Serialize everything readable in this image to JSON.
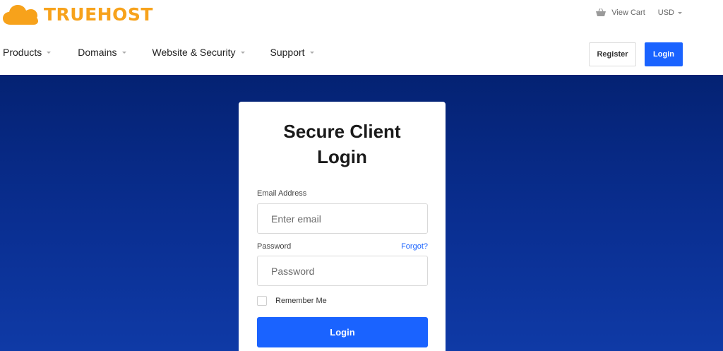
{
  "brand": {
    "name": "TRUEHOST",
    "logo_icon": "cloud-icon",
    "color": "#f7a21b"
  },
  "topbar": {
    "cart_label": "View Cart",
    "cart_icon": "basket-icon",
    "currency": "USD"
  },
  "nav": {
    "items": [
      {
        "label": "Products"
      },
      {
        "label": "Domains"
      },
      {
        "label": "Website & Security"
      },
      {
        "label": "Support"
      }
    ]
  },
  "header_buttons": {
    "register": "Register",
    "login": "Login"
  },
  "login_form": {
    "title_line1": "Secure Client",
    "title_line2": "Login",
    "email_label": "Email Address",
    "email_placeholder": "Enter email",
    "password_label": "Password",
    "forgot_label": "Forgot?",
    "password_placeholder": "Password",
    "remember_label": "Remember Me",
    "submit_label": "Login"
  },
  "colors": {
    "accent": "#1a63ff",
    "hero_top": "#042273",
    "hero_bottom": "#0f3aa6"
  }
}
